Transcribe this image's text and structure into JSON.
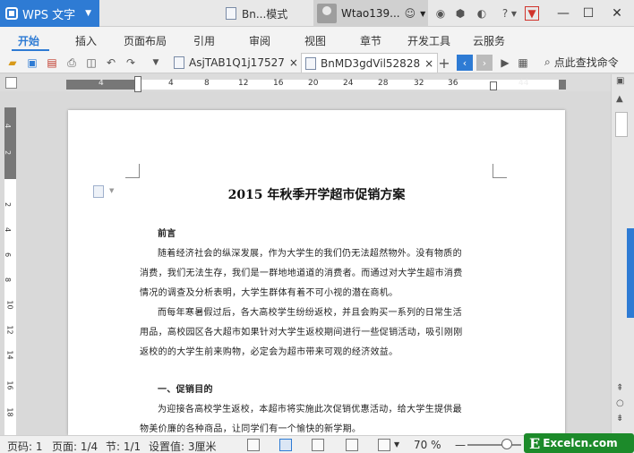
{
  "app": {
    "menu_label": "WPS 文字",
    "doc_tab_short": "Bn...模式",
    "user_name": "Wtao139..."
  },
  "menu": {
    "items": [
      "开始",
      "插入",
      "页面布局",
      "引用",
      "审阅",
      "视图",
      "章节",
      "开发工具",
      "云服务"
    ],
    "active": "开始"
  },
  "toolbar": {
    "tabs": [
      {
        "label": "AsjTAB1Q1j17527",
        "close": "×"
      },
      {
        "label": "BnMD3gdVil52828",
        "close": "×"
      }
    ],
    "add_tab": "+",
    "search_label": "点此查找命令"
  },
  "ruler": {
    "ticks": [
      "4",
      "4",
      "8",
      "12",
      "16",
      "20",
      "24",
      "28",
      "32",
      "36",
      "44"
    ],
    "vticks": [
      "4",
      "2",
      "2",
      "4",
      "6",
      "8",
      "10",
      "12",
      "14",
      "16",
      "18"
    ]
  },
  "document": {
    "title": "2015 年秋季开学超市促销方案",
    "paragraphs": [
      {
        "type": "heading",
        "text": "前言"
      },
      {
        "type": "line",
        "text": "随着经济社会的纵深发展，作为大学生的我们仍无法超然物外。没有物质的"
      },
      {
        "type": "line",
        "text": "消费，我们无法生存，我们是一群地地道道的消费者。而通过对大学生超市消费"
      },
      {
        "type": "line",
        "text": "情况的调查及分析表明，大学生群体有着不可小视的潜在商机。"
      },
      {
        "type": "line",
        "text": "而每年寒暑假过后，各大高校学生纷纷返校，并且会购买一系列的日常生活"
      },
      {
        "type": "line",
        "text": "用品，高校园区各大超市如果针对大学生返校期间进行一些促销活动，吸引刚刚"
      },
      {
        "type": "line",
        "text": "返校的的大学生前来购物，必定会为超市带来可观的经济效益。"
      },
      {
        "type": "heading",
        "text": "一、促销目的"
      },
      {
        "type": "line",
        "text": "为迎接各高校学生返校，本超市将实施此次促销优惠活动，给大学生提供最"
      },
      {
        "type": "line",
        "text": "物美价廉的各种商品，让同学们有一个愉快的新学期。"
      }
    ]
  },
  "status": {
    "page_no": "页码: 1",
    "page_count": "页面: 1/4",
    "section": "节: 1/1",
    "setting": "设置值: 3厘米",
    "zoom": "70 %",
    "zoom_level": 0.7,
    "logo_text": "Excelcn.com",
    "logo_letter": "E"
  },
  "colors": {
    "accent": "#2e7bd4",
    "logo_green": "#1c8a2a"
  }
}
